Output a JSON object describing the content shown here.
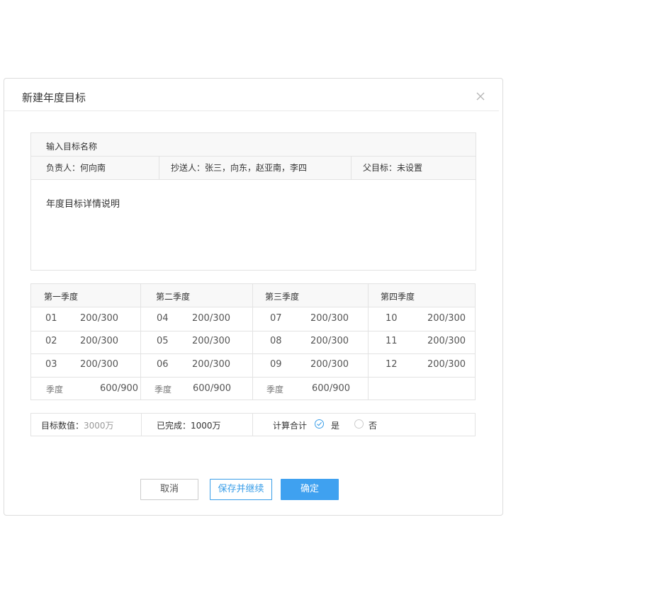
{
  "dialog": {
    "title": "新建年度目标",
    "close_icon": "close-icon"
  },
  "form": {
    "name_placeholder": "输入目标名称",
    "owner": "负责人：何向南",
    "cc": "抄送人：张三，向东，赵亚南，李四",
    "parent": "父目标：未设置",
    "description": "年度目标详情说明"
  },
  "quarters": [
    {
      "header": "第一季度",
      "months": [
        {
          "m": "01",
          "v": "200/300"
        },
        {
          "m": "02",
          "v": "200/300"
        },
        {
          "m": "03",
          "v": "200/300"
        }
      ],
      "sum_label": "季度",
      "sum_value": "600/900"
    },
    {
      "header": "第二季度",
      "months": [
        {
          "m": "04",
          "v": "200/300"
        },
        {
          "m": "05",
          "v": "200/300"
        },
        {
          "m": "06",
          "v": "200/300"
        }
      ],
      "sum_label": "季度",
      "sum_value": "600/900"
    },
    {
      "header": "第三季度",
      "months": [
        {
          "m": "07",
          "v": "200/300"
        },
        {
          "m": "08",
          "v": "200/300"
        },
        {
          "m": "09",
          "v": "200/300"
        }
      ],
      "sum_label": "季度",
      "sum_value": "600/900"
    },
    {
      "header": "第四季度",
      "months": [
        {
          "m": "10",
          "v": "200/300"
        },
        {
          "m": "11",
          "v": "200/300"
        },
        {
          "m": "12",
          "v": "200/300"
        }
      ]
    }
  ],
  "summary": {
    "target_label": "目标数值：",
    "target_value": "3000万",
    "done": "已完成：1000万",
    "calc_label": "计算合计",
    "yes": "是",
    "no": "否",
    "calc_selected": "是"
  },
  "buttons": {
    "cancel": "取消",
    "save_continue": "保存并继续",
    "confirm": "确定"
  },
  "colors": {
    "accent": "#3fa1f0",
    "border": "#e3e3e3",
    "header_bg": "#f8f8f8"
  }
}
